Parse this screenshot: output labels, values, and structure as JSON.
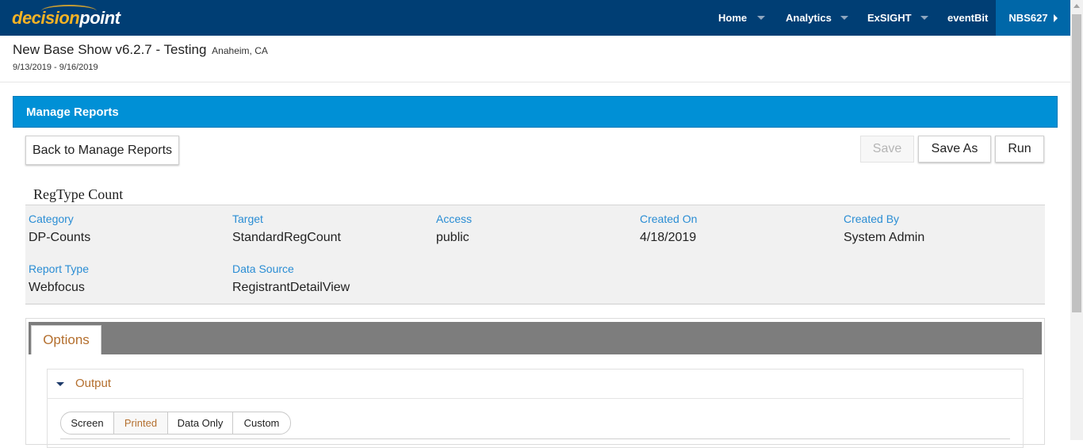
{
  "colors": {
    "nav_bg": "#003e74",
    "nav_active_bg": "#0067a8",
    "logo_accent": "#f5b325",
    "banner_bg": "#0090d6",
    "label_blue": "#2a8dd4",
    "accent_orange": "#b46f2e",
    "tabbar_bg": "#7d7d7d"
  },
  "logo": {
    "part1": "decision",
    "part2": "point"
  },
  "nav": {
    "items": [
      {
        "label": "Home",
        "dropdown": true
      },
      {
        "label": "Analytics",
        "dropdown": true
      },
      {
        "label": "ExSIGHT",
        "dropdown": true
      },
      {
        "label": "eventBit",
        "dropdown": false
      }
    ],
    "active": {
      "label": "NBS627",
      "icon": "caret-right-icon"
    }
  },
  "show": {
    "title": "New Base Show v6.2.7 - Testing",
    "location": "Anaheim, CA",
    "dates": "9/13/2019 - 9/16/2019"
  },
  "banner": {
    "title": "Manage Reports"
  },
  "toolbar": {
    "back_label": "Back to Manage Reports",
    "save_label": "Save",
    "save_as_label": "Save As",
    "run_label": "Run"
  },
  "report": {
    "name": "RegType Count",
    "fields": [
      {
        "label": "Category",
        "value": "DP-Counts"
      },
      {
        "label": "Target",
        "value": "StandardRegCount"
      },
      {
        "label": "Access",
        "value": "public"
      },
      {
        "label": "Created On",
        "value": "4/18/2019"
      },
      {
        "label": "Created By",
        "value": "System Admin"
      },
      {
        "label": "Report Type",
        "value": "Webfocus"
      },
      {
        "label": "Data Source",
        "value": "RegistrantDetailView"
      }
    ]
  },
  "tabs": [
    {
      "label": "Options",
      "active": true
    }
  ],
  "output": {
    "title": "Output",
    "expanded": true,
    "options": [
      {
        "label": "Screen",
        "selected": false
      },
      {
        "label": "Printed",
        "selected": true
      },
      {
        "label": "Data Only",
        "selected": false
      },
      {
        "label": "Custom",
        "selected": false
      }
    ]
  }
}
